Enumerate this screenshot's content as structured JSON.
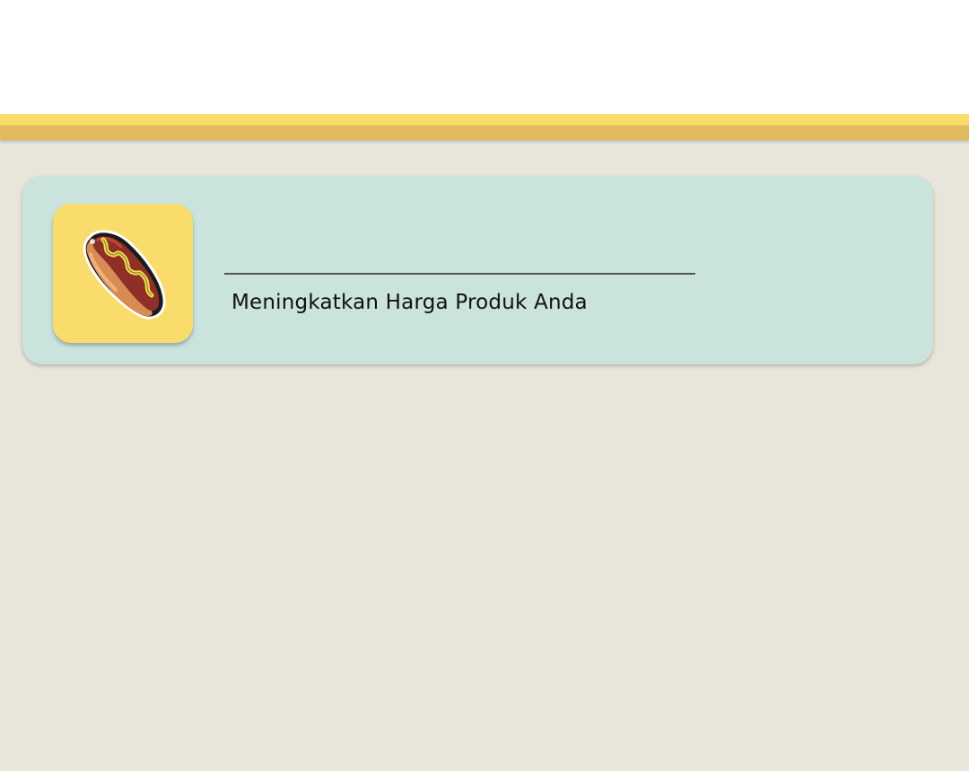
{
  "header": {
    "band_color": "#f9dc6b",
    "band_shadow_color": "#e0ba5c"
  },
  "upgrade_card": {
    "icon": "hotdog-icon",
    "title": "Meningkatkan Harga Produk Anda",
    "background_color": "#cae3dc",
    "icon_tile_color": "#f9dc6b"
  },
  "page": {
    "background_color": "#e8e5da"
  }
}
